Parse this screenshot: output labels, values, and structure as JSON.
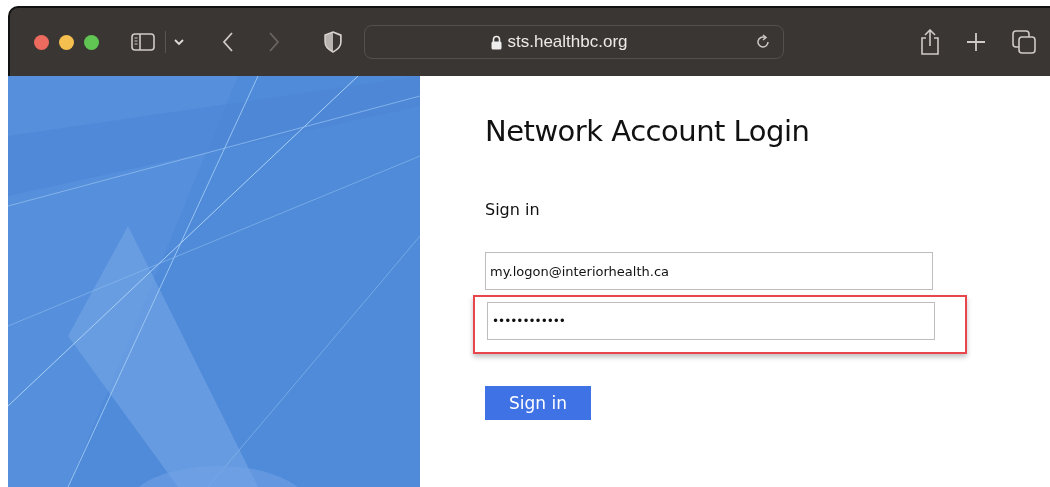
{
  "browser": {
    "address": "sts.healthbc.org"
  },
  "login": {
    "title": "Network Account Login",
    "subtitle": "Sign in",
    "fields": [
      {
        "kind": "email",
        "value": "my.logon@interiorhealth.ca",
        "highlighted": false
      },
      {
        "kind": "password",
        "value": "••••••••••••",
        "highlighted": true
      }
    ],
    "button": "Sign in"
  }
}
